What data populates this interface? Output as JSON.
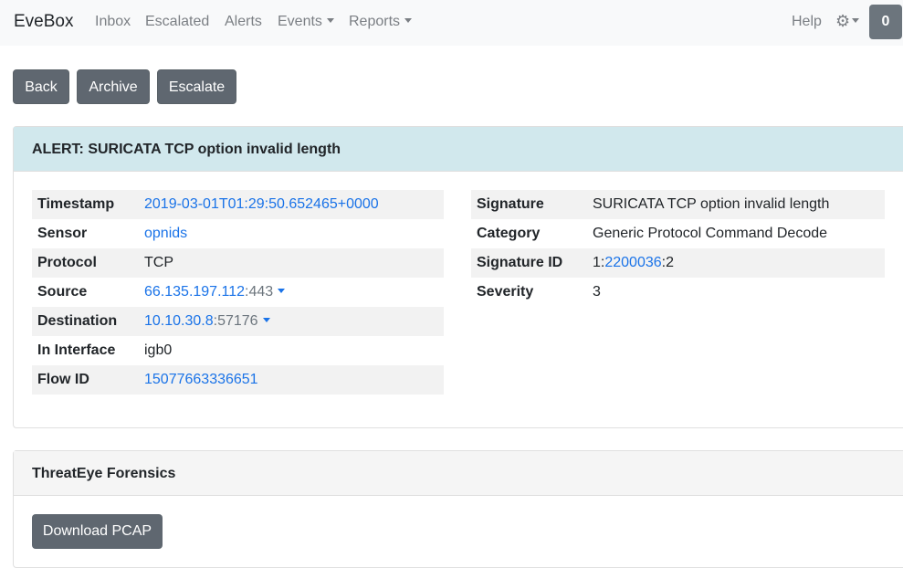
{
  "navbar": {
    "brand": "EveBox",
    "items": [
      {
        "label": "Inbox"
      },
      {
        "label": "Escalated"
      },
      {
        "label": "Alerts"
      },
      {
        "label": "Events"
      },
      {
        "label": "Reports"
      }
    ],
    "help": "Help",
    "counter": "0"
  },
  "actions": {
    "back": "Back",
    "archive": "Archive",
    "escalate": "Escalate"
  },
  "alert": {
    "title": "ALERT: SURICATA TCP option invalid length",
    "left": {
      "timestamp_label": "Timestamp",
      "timestamp": "2019-03-01T01:29:50.652465+0000",
      "sensor_label": "Sensor",
      "sensor": "opnids",
      "protocol_label": "Protocol",
      "protocol": "TCP",
      "source_label": "Source",
      "source_ip": "66.135.197.112",
      "source_port": ":443",
      "destination_label": "Destination",
      "destination_ip": "10.10.30.8",
      "destination_port": ":57176",
      "in_interface_label": "In Interface",
      "in_interface": "igb0",
      "flow_id_label": "Flow ID",
      "flow_id": "15077663336651"
    },
    "right": {
      "signature_label": "Signature",
      "signature": "SURICATA TCP option invalid length",
      "category_label": "Category",
      "category": "Generic Protocol Command Decode",
      "signature_id_label": "Signature ID",
      "sig_gid": "1:",
      "sig_id": "2200036",
      "sig_rev": ":2",
      "severity_label": "Severity",
      "severity": "3"
    }
  },
  "forensics": {
    "title": "ThreatEye Forensics",
    "download": "Download PCAP"
  },
  "colors": {
    "navbar_bg": "#f8f9fa",
    "button_bg": "#5f6770",
    "alert_header_bg": "#d1e8ed",
    "link": "#1a73e8",
    "stripe": "#f2f2f2"
  }
}
